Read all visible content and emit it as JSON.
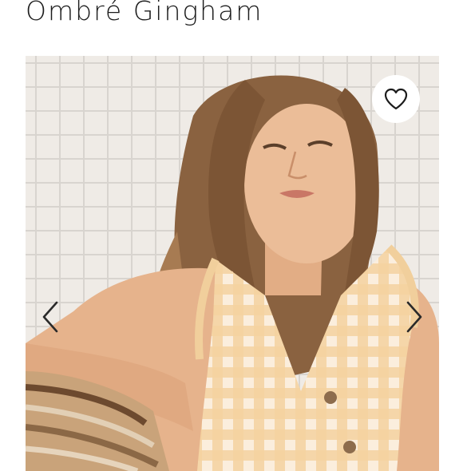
{
  "product": {
    "title": "Ombré Gingham"
  },
  "gallery": {
    "favorite_icon": "heart-outline-icon",
    "prev_icon": "chevron-left-icon",
    "next_icon": "chevron-right-icon"
  },
  "colors": {
    "background": "#ffffff",
    "title_text": "#1c1c1c",
    "tile_wall": "#efebe6",
    "tile_grout": "#d8d4cf",
    "gingham_top": "#f3d6a8",
    "hair": "#8a6240",
    "skin": "#e8b994"
  }
}
